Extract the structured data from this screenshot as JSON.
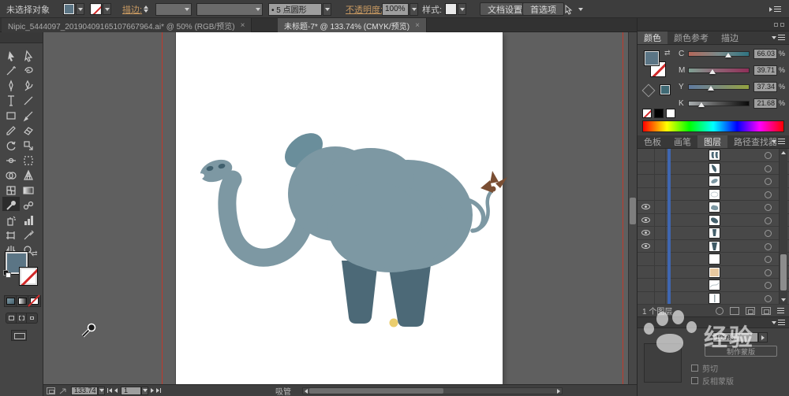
{
  "control_bar": {
    "selection_status": "未选择对象",
    "stroke_label": "描边:",
    "brush_preset": "• 5 点圆形",
    "opacity_label": "不透明度:",
    "opacity_value": "100%",
    "style_label": "样式:",
    "document_setup_button": "文档设置",
    "preferences_button": "首选项"
  },
  "tabs": [
    {
      "title": "Nipic_5444097_20190409165107667964.ai* @ 50% (RGB/预览)"
    },
    {
      "title": "未标题-7* @ 133.74% (CMYK/预览)"
    }
  ],
  "icons": {
    "close": "×",
    "swap": "⇄"
  },
  "color_panel": {
    "tabs": [
      "颜色",
      "颜色参考",
      "描边"
    ],
    "sliders": [
      {
        "channel": "C",
        "value": "66.03"
      },
      {
        "channel": "M",
        "value": "39.71"
      },
      {
        "channel": "Y",
        "value": "37.34"
      },
      {
        "channel": "K",
        "value": "21.68"
      }
    ],
    "unit": "%"
  },
  "panel_tabs": [
    "色板",
    "画笔",
    "图层",
    "路径查找器"
  ],
  "layers_panel": {
    "footer_count": "1 个图层",
    "rows": [
      {
        "eye": false,
        "thumb": "feet-pair"
      },
      {
        "eye": false,
        "thumb": "trunk-curve"
      },
      {
        "eye": false,
        "thumb": "leaf-shape"
      },
      {
        "eye": false,
        "thumb": "ellipse-outline"
      },
      {
        "eye": true,
        "thumb": "body-blob"
      },
      {
        "eye": true,
        "thumb": "dark-leaf"
      },
      {
        "eye": true,
        "thumb": "leg-shape"
      },
      {
        "eye": true,
        "thumb": "leg-shape-2"
      },
      {
        "eye": false,
        "thumb": "blank"
      },
      {
        "eye": false,
        "thumb": "tan-fill"
      },
      {
        "eye": false,
        "thumb": "light-curve"
      },
      {
        "eye": false,
        "thumb": "thin-line"
      }
    ]
  },
  "transparency_panel": {
    "opacity_value": "100%",
    "make_mask_button": "制作蒙版",
    "clip_label": "剪切",
    "invert_mask_label": "反相蒙版"
  },
  "status_bar": {
    "zoom_value": "133.74",
    "artboard_number": "1",
    "tool_name": "吸管"
  },
  "watermark": {
    "text": "经验"
  },
  "colors": {
    "elephant-body": "#7d98a3",
    "elephant-legs": "#4c6977",
    "elephant-ear": "#6a8e9b",
    "elephant-tuft": "#7a4e33",
    "elephant-dot": "#eacd6e",
    "nostril": "#3f5f6d",
    "selection-accent": "#3f66b0",
    "guide-red": "#c0392b",
    "fill-swatch": "#5b7585",
    "link-gold": "#c99a62"
  }
}
